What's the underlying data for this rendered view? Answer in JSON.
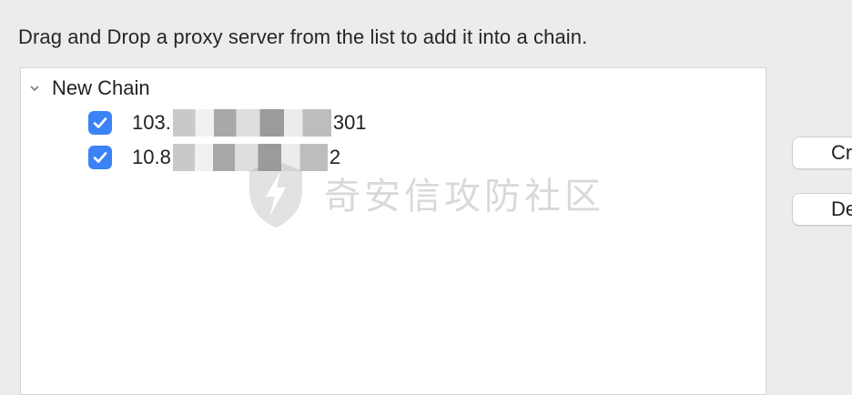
{
  "instruction": "Drag and Drop a proxy server from the list to add it into a chain.",
  "chain": {
    "name": "New Chain",
    "items": [
      {
        "prefix": "103.",
        "suffix": "301",
        "checked": true
      },
      {
        "prefix": "10.8",
        "suffix": "2",
        "checked": true
      }
    ]
  },
  "watermark": {
    "text": "奇安信攻防社区"
  },
  "buttons": {
    "create_label": "Cr",
    "delete_label": "De"
  },
  "colors": {
    "checkbox": "#3b82f6"
  },
  "icons": {
    "expand": "chevron-down-icon",
    "check": "checkmark-icon"
  }
}
